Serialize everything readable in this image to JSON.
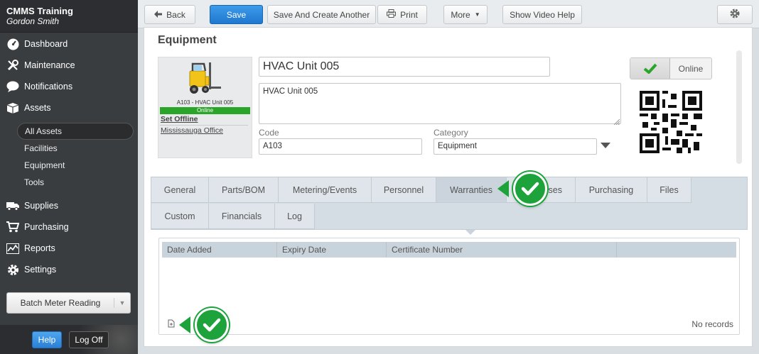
{
  "brand": {
    "app_name": "CMMS Training",
    "user_name": "Gordon Smith"
  },
  "sidebar": {
    "nav": [
      {
        "label": "Dashboard",
        "icon": "dashboard-gauge-icon"
      },
      {
        "label": "Maintenance",
        "icon": "wrench-icon"
      },
      {
        "label": "Notifications",
        "icon": "speech-bubble-icon"
      },
      {
        "label": "Assets",
        "icon": "box-icon"
      }
    ],
    "asset_sub": [
      "All Assets",
      "Facilities",
      "Equipment",
      "Tools"
    ],
    "nav2": [
      {
        "label": "Supplies",
        "icon": "truck-icon"
      },
      {
        "label": "Purchasing",
        "icon": "cart-icon"
      },
      {
        "label": "Reports",
        "icon": "chart-icon"
      },
      {
        "label": "Settings",
        "icon": "gear-icon"
      }
    ],
    "batch_label": "Batch Meter Reading",
    "help_label": "Help",
    "logoff_label": "Log Off"
  },
  "toolbar": {
    "back": "Back",
    "save": "Save",
    "save_and_create": "Save And Create Another",
    "print": "Print",
    "more": "More",
    "video_help": "Show Video Help"
  },
  "equipment": {
    "heading": "Equipment",
    "asset_caption": "A103 - HVAC Unit 005",
    "status_strip": "Online",
    "set_offline": "Set Offline",
    "location_link": "Mississauga Office",
    "name": "HVAC Unit 005",
    "description": "HVAC Unit 005",
    "code_label": "Code",
    "code_value": "A103",
    "category_label": "Category",
    "category_value": "Equipment",
    "online_label": "Online"
  },
  "tabs": {
    "row1": [
      "General",
      "Parts/BOM",
      "Metering/Events",
      "Personnel",
      "Warranties",
      "ses",
      "Purchasing",
      "Files"
    ],
    "row2": [
      "Custom",
      "Financials",
      "Log"
    ],
    "active": "Warranties"
  },
  "grid": {
    "columns": [
      "Date Added",
      "Expiry Date",
      "Certificate Number",
      ""
    ],
    "empty_text": "No records"
  },
  "colors": {
    "primary": "#2a80d6",
    "online_green": "#2aa52a",
    "callout_green": "#1ea23b",
    "sidebar_bg": "#3a3d40"
  }
}
